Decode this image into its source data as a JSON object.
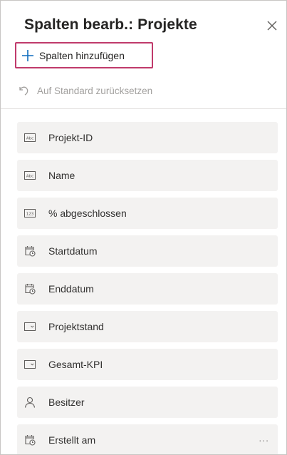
{
  "panel": {
    "title": "Spalten bearb.: Projekte",
    "close_icon": "close-icon",
    "add_columns_label": "Spalten hinzufügen",
    "reset_label": "Auf Standard zurücksetzen",
    "accent_color": "#c03a6b"
  },
  "columns": [
    {
      "label": "Projekt-ID",
      "icon": "text-field-icon"
    },
    {
      "label": "Name",
      "icon": "text-field-icon"
    },
    {
      "label": "% abgeschlossen",
      "icon": "number-field-icon"
    },
    {
      "label": "Startdatum",
      "icon": "calendar-clock-icon"
    },
    {
      "label": "Enddatum",
      "icon": "calendar-clock-icon"
    },
    {
      "label": "Projektstand",
      "icon": "choice-field-icon"
    },
    {
      "label": "Gesamt-KPI",
      "icon": "choice-field-icon"
    },
    {
      "label": "Besitzer",
      "icon": "person-icon"
    },
    {
      "label": "Erstellt am",
      "icon": "calendar-clock-icon",
      "more": "..."
    }
  ]
}
